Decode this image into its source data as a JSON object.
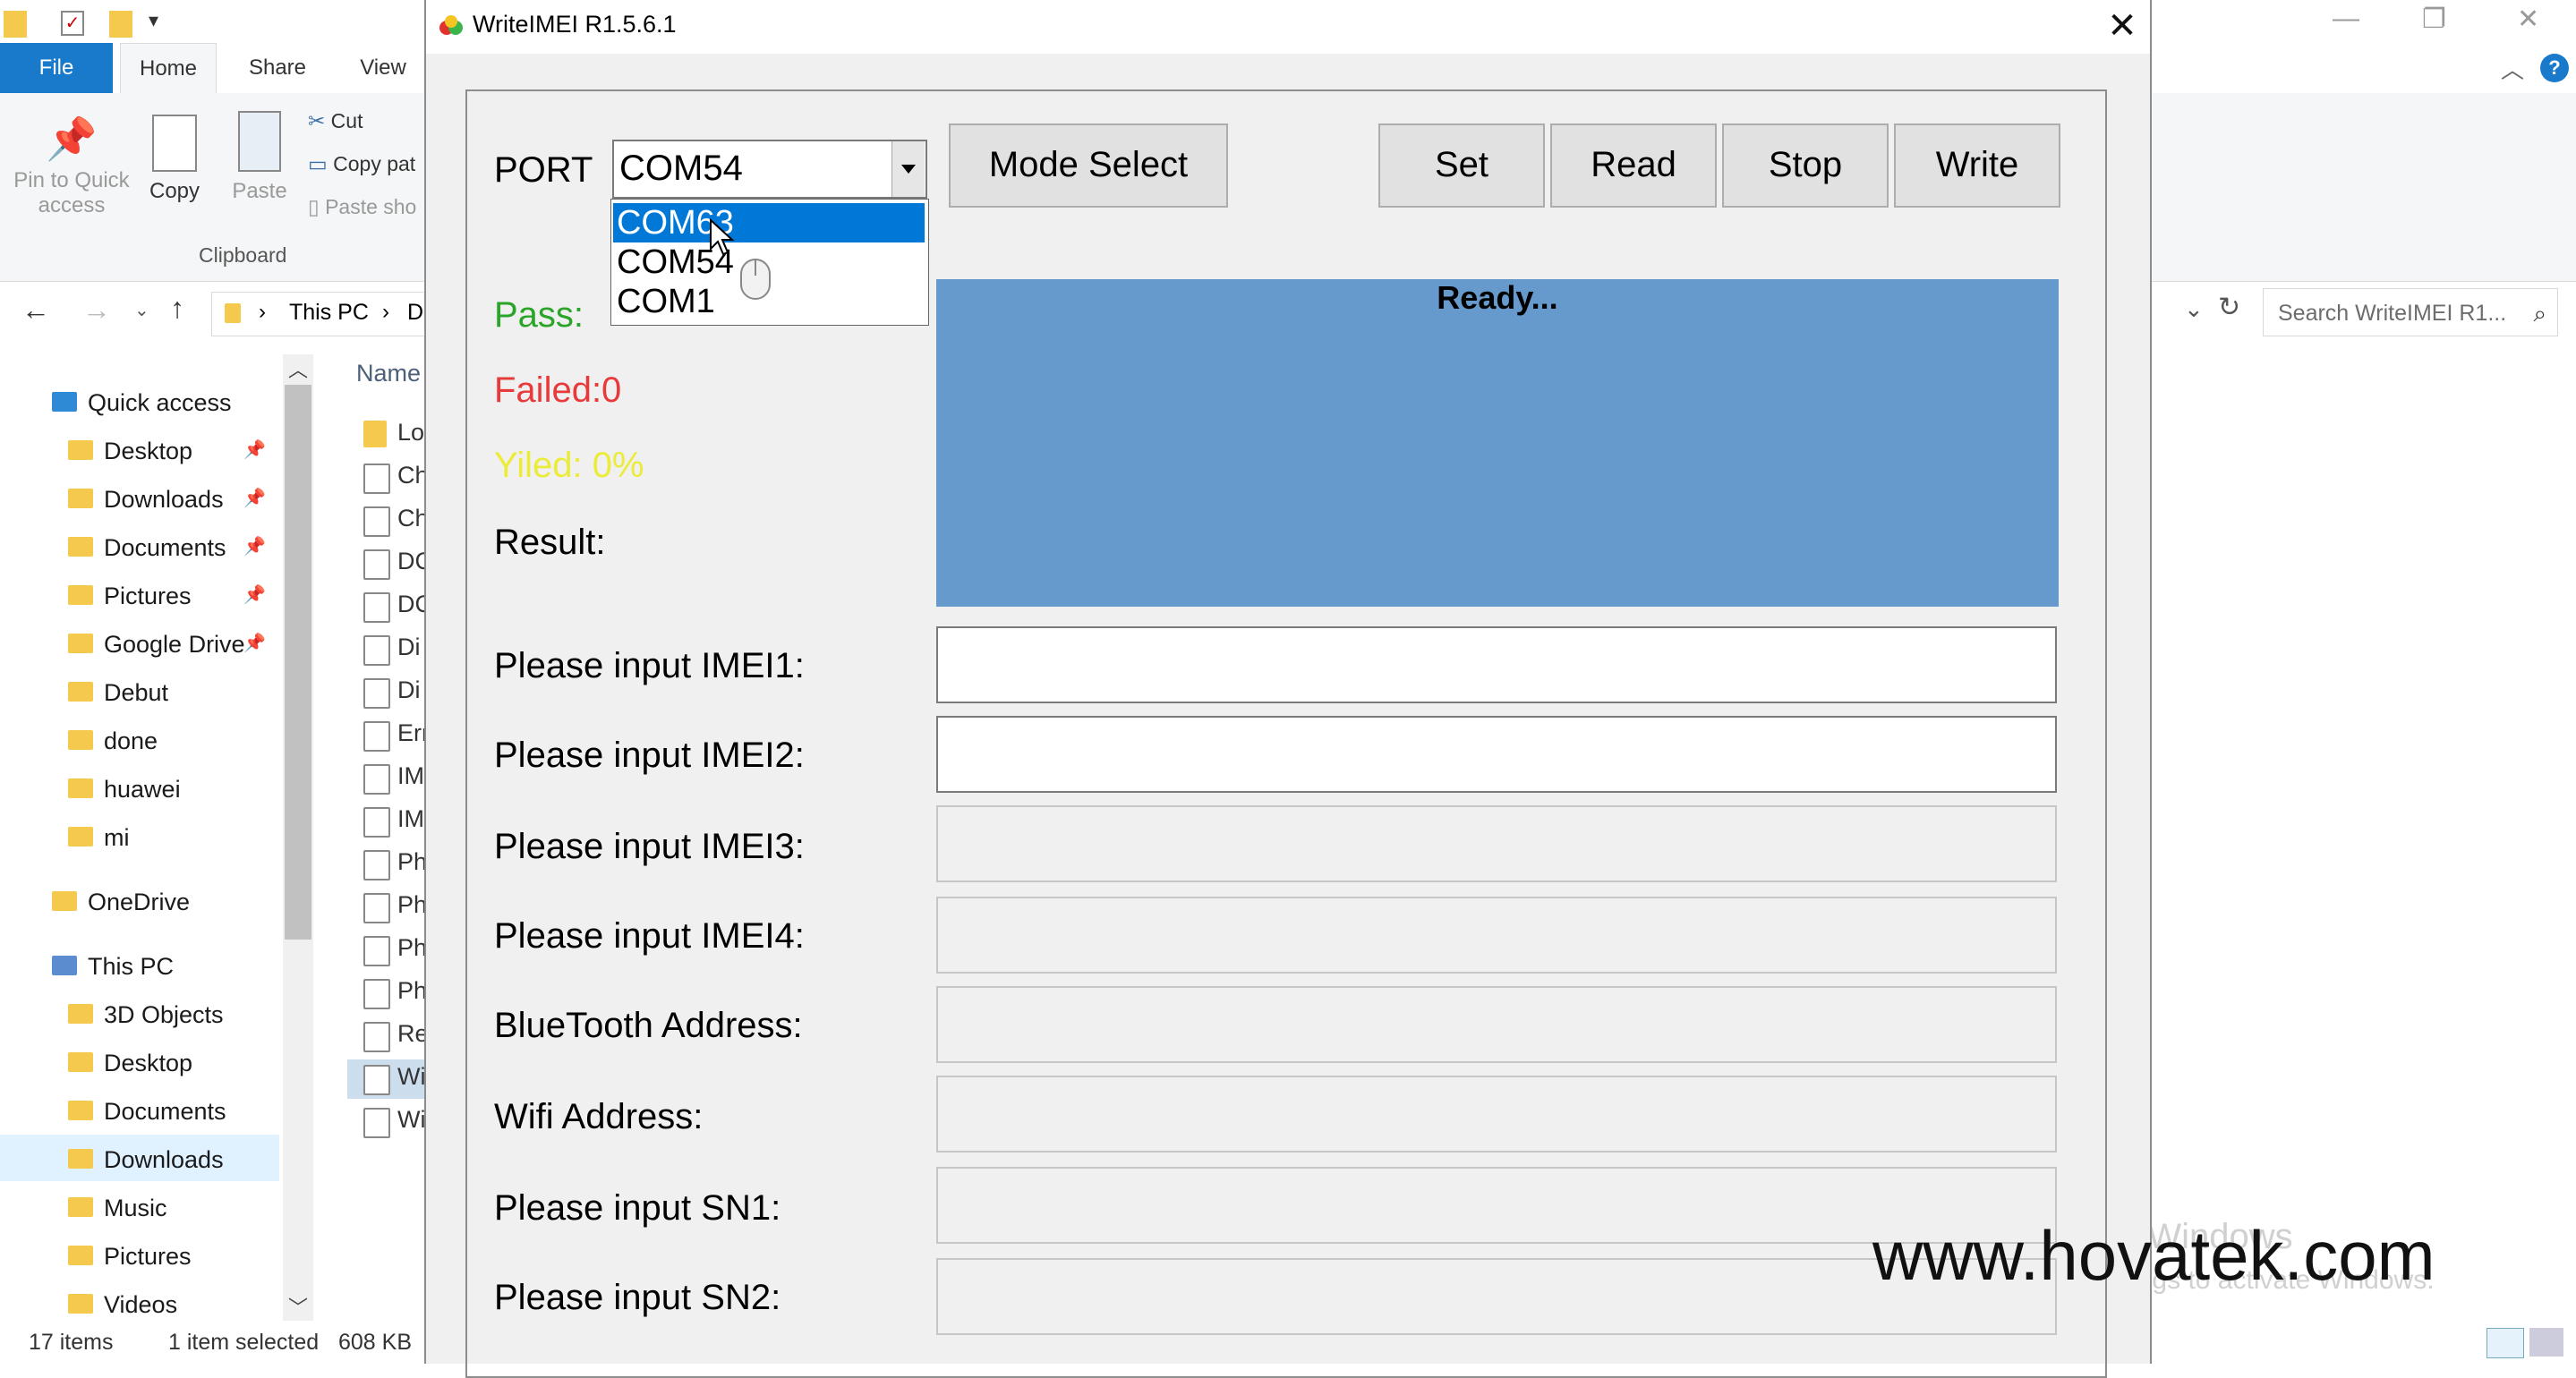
{
  "explorer": {
    "tabs": {
      "file": "File",
      "home": "Home",
      "share": "Share",
      "view": "View"
    },
    "ribbon": {
      "pin": "Pin to Quick access",
      "copy": "Copy",
      "paste": "Paste",
      "cut": "Cut",
      "copy_path": "Copy pat",
      "paste_shortcut": "Paste sho",
      "group_label": "Clipboard"
    },
    "address": {
      "this_pc": "This PC",
      "next_crumb": "D"
    },
    "search_placeholder": "Search WriteIMEI R1...",
    "name_header": "Name",
    "nav": {
      "quick_access": "Quick access",
      "quick_items": [
        "Desktop",
        "Downloads",
        "Documents",
        "Pictures",
        "Google Drive",
        "Debut",
        "done",
        "huawei",
        "mi"
      ],
      "onedrive": "OneDrive",
      "this_pc": "This PC",
      "pc_items": [
        "3D Objects",
        "Desktop",
        "Documents",
        "Downloads",
        "Music",
        "Pictures",
        "Videos"
      ]
    },
    "files": [
      "Lo",
      "Ch",
      "Ch",
      "DC",
      "DC",
      "Di",
      "Di",
      "Err",
      "IM",
      "IM",
      "Ph",
      "Ph",
      "Ph",
      "Ph",
      "Re",
      "Wi",
      "Wi"
    ],
    "status": {
      "count": "17 items",
      "selected": "1 item selected",
      "size": "608 KB"
    },
    "activate_line1": "Activate Windows",
    "activate_line2": "Go to Settings to activate Windows."
  },
  "dialog": {
    "title": "WriteIMEI R1.5.6.1",
    "port_label": "PORT",
    "port_value": "COM54",
    "port_options": [
      "COM63",
      "COM54",
      "COM1"
    ],
    "buttons": {
      "mode_select": "Mode Select",
      "set": "Set",
      "read": "Read",
      "stop": "Stop",
      "write": "Write"
    },
    "pass": "Pass:",
    "failed": "Failed:0",
    "yield": "Yiled:  0%",
    "result": "Result:",
    "status_text": "Ready...",
    "fields": [
      {
        "label": "Please input IMEI1:",
        "value": "",
        "enabled": true
      },
      {
        "label": "Please input IMEI2:",
        "value": "",
        "enabled": true
      },
      {
        "label": "Please input IMEI3:",
        "value": "",
        "enabled": false
      },
      {
        "label": "Please input IMEI4:",
        "value": "",
        "enabled": false
      },
      {
        "label": "BlueTooth Address:",
        "value": "",
        "enabled": false
      },
      {
        "label": "Wifi Address:",
        "value": "",
        "enabled": false
      },
      {
        "label": "Please input SN1:",
        "value": "",
        "enabled": false
      },
      {
        "label": "Please input SN2:",
        "value": "",
        "enabled": false
      }
    ],
    "colors": {
      "pass": "#2aa52a",
      "failed": "#e83a3a",
      "yield": "#ecec38",
      "status_panel": "#6699cc"
    }
  },
  "watermark": "www.hovatek.com"
}
